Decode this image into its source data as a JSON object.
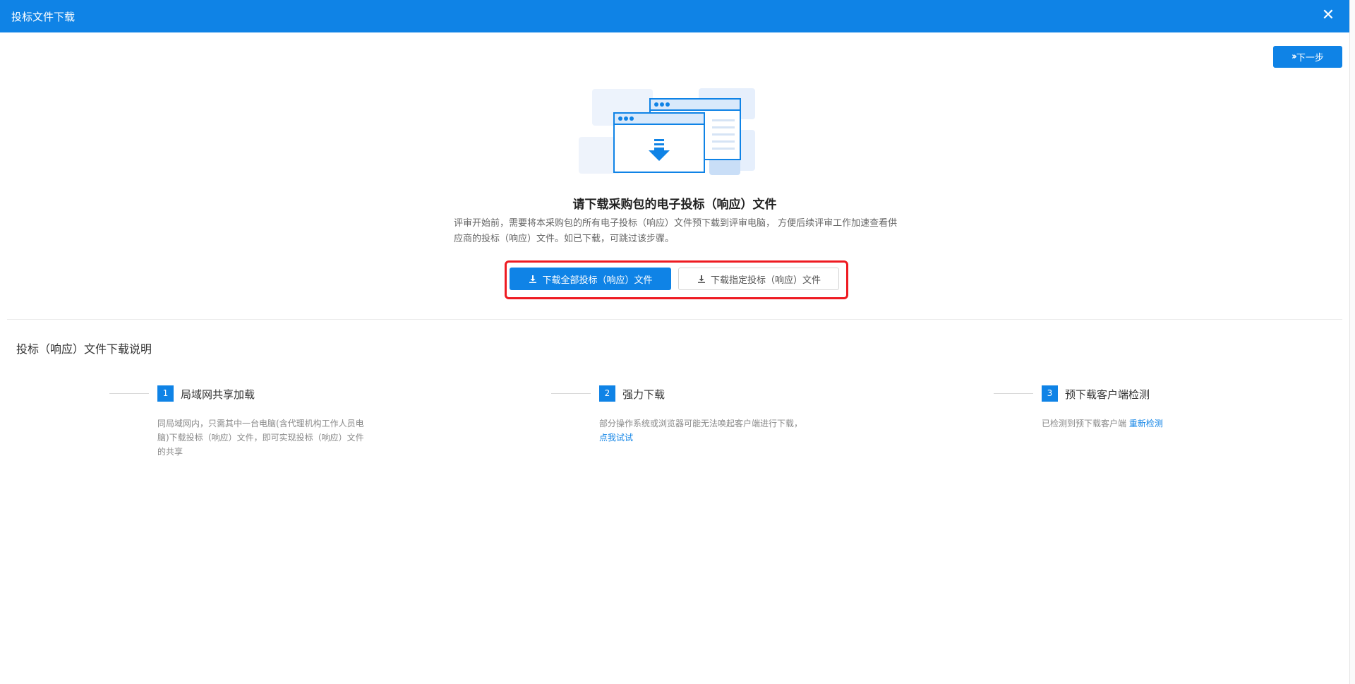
{
  "window": {
    "title": "投标文件下载",
    "close_glyph": "✕"
  },
  "toolbar": {
    "next_label": "下一步"
  },
  "main": {
    "heading": "请下载采购包的电子投标（响应）文件",
    "description": "评审开始前，需要将本采购包的所有电子投标（响应）文件预下载到评审电脑， 方便后续评审工作加速查看供应商的投标（响应）文件。如已下载，可跳过该步骤。",
    "download_all_label": "下载全部投标（响应）文件",
    "download_selected_label": "下载指定投标（响应）文件"
  },
  "instructions": {
    "title": "投标（响应）文件下载说明",
    "steps": [
      {
        "number": "1",
        "label": "局域网共享加载",
        "text": "同局域网内，只需其中一台电脑(含代理机构工作人员电脑)下载投标（响应）文件，即可实现投标（响应）文件的共享"
      },
      {
        "number": "2",
        "label": "强力下载",
        "text": "部分操作系统或浏览器可能无法唤起客户端进行下载，",
        "link": "点我试试"
      },
      {
        "number": "3",
        "label": "预下载客户端检测",
        "text": "已检测到预下载客户端 ",
        "link": "重新检测"
      }
    ]
  },
  "colors": {
    "primary": "#0f83e6",
    "highlight": "#ee1b22"
  },
  "icons": [
    "close-icon",
    "double-chevron-right-icon",
    "download-icon",
    "download-illustration"
  ]
}
